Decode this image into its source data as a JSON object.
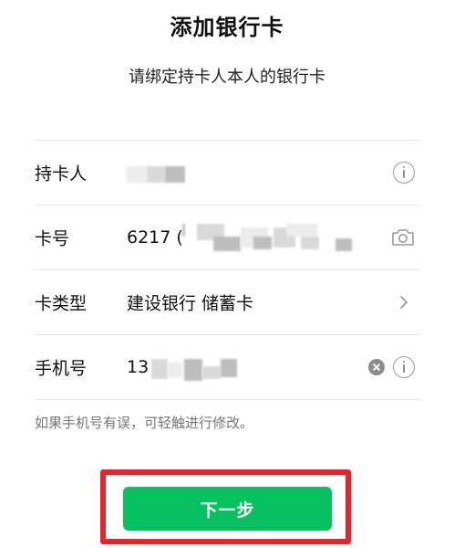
{
  "header": {
    "title": "添加银行卡",
    "subtitle": "请绑定持卡人本人的银行卡"
  },
  "form": {
    "cardholder": {
      "label": "持卡人",
      "value": ""
    },
    "card_number": {
      "label": "卡号",
      "value": "6217 ("
    },
    "card_type": {
      "label": "卡类型",
      "value": "建设银行 储蓄卡"
    },
    "phone": {
      "label": "手机号",
      "value": "13"
    }
  },
  "hint": "如果手机号有误，可轻触进行修改。",
  "next_button": {
    "label": "下一步",
    "color": "#07c160"
  },
  "highlight_color": "#e5252a",
  "icons": {
    "cardholder_info": "info-icon",
    "card_number_scan": "camera-icon",
    "card_type_select": "chevron-right-icon",
    "phone_clear": "clear-icon",
    "phone_info": "info-icon"
  }
}
